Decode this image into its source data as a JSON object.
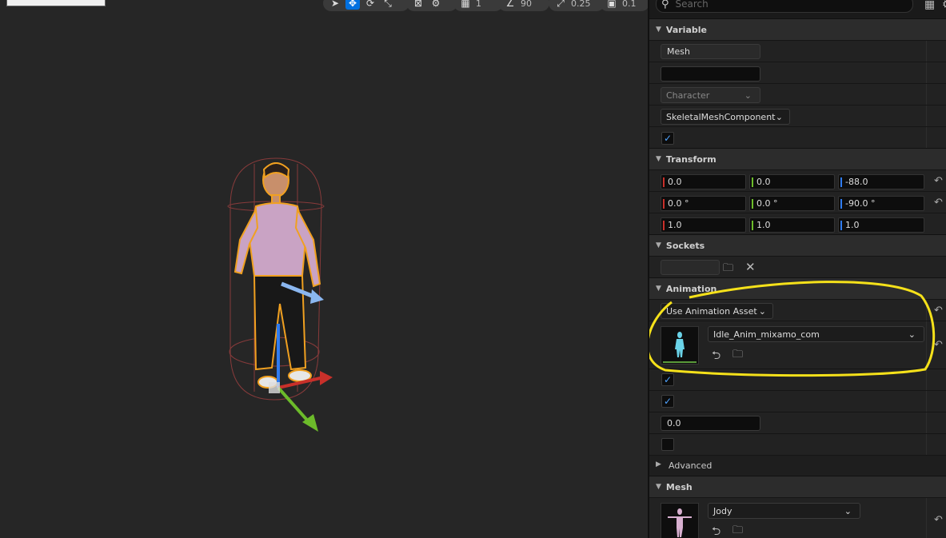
{
  "toolbar": {
    "grid_value": "1",
    "angle_value": "90",
    "scale_value": "0.25",
    "camera_value": "0.1"
  },
  "search": {
    "placeholder": "Search"
  },
  "sections": {
    "variable": "Variable",
    "transform": "Transform",
    "sockets": "Sockets",
    "animation": "Animation",
    "advanced": "Advanced",
    "mesh": "Mesh"
  },
  "variable": {
    "name": "Mesh",
    "tooltip": "",
    "category": "Character",
    "type": "SkeletalMeshComponent",
    "editable": true
  },
  "transform": {
    "location": [
      "0.0",
      "0.0",
      "-88.0"
    ],
    "rotation": [
      "0.0 °",
      "0.0 °",
      "-90.0 °"
    ],
    "scale": [
      "1.0",
      "1.0",
      "1.0"
    ]
  },
  "animation": {
    "mode": "Use Animation Asset",
    "asset": "Idle_Anim_mixamo_com",
    "looping": true,
    "playing": true,
    "initial_position": "0.0",
    "extra": false
  },
  "mesh": {
    "asset": "Jody"
  },
  "colors": {
    "x_axis": "#c8302a",
    "y_axis": "#6cbb2a",
    "z_axis": "#2f7cf0",
    "accent": "#0070e0",
    "highlight": "#f5e11a"
  }
}
